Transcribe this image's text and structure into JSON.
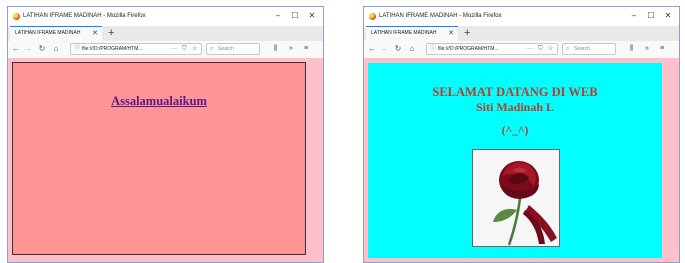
{
  "windows": [
    {
      "title": "LATIHAN IFRAME MADINAH - Mozilla Firefox",
      "tab_label": "LATIHAN IFRAME MADINAH",
      "url": "file:///D:/PROGRAM/HTM...",
      "search_placeholder": "Search",
      "page": {
        "greeting": "Assalamualaikum",
        "bg_color": "#ff9494"
      }
    },
    {
      "title": "LATIHAN IFRAME MADINAH - Mozilla Firefox",
      "tab_label": "LATIHAN IFRAME MADINAH",
      "url": "file:///D:/PROGRAM/HTM...",
      "search_placeholder": "Search",
      "page": {
        "heading": "SELAMAT DATANG DI WEB",
        "name": "Siti Madinah L",
        "emoticon": "(^_^)",
        "image": "rose-photo",
        "bg_color": "#00ffff"
      }
    }
  ],
  "controls": {
    "minimize": "–",
    "maximize": "☐",
    "close": "✕",
    "tab_close": "✕",
    "new_tab": "+"
  },
  "nav": {
    "back": "←",
    "forward": "→",
    "reload": "↻",
    "home": "⌂",
    "page_actions": "···",
    "pocket": "⛉",
    "bookmark": "☆",
    "search_glyph": "⌕",
    "library": "⫼",
    "overflow": "»",
    "menu": "≡",
    "info": "ⓘ"
  },
  "colors": {
    "window_border": "#8aa2c8",
    "content_pink": "#ffc0cb",
    "heading_red": "#c0392b",
    "link_purple": "#551a8b"
  }
}
